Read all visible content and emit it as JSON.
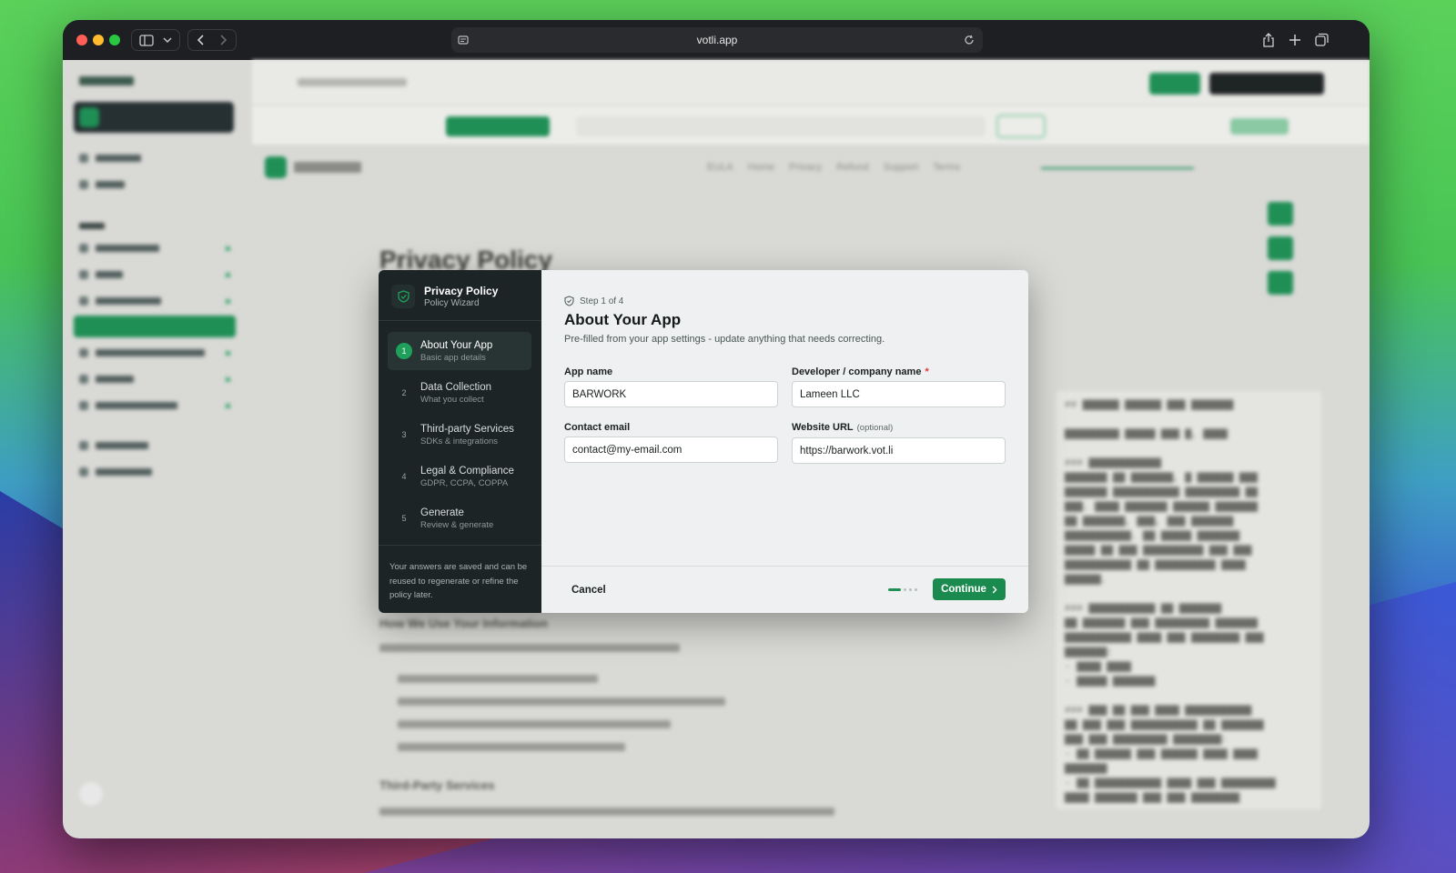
{
  "browser": {
    "url": "votli.app"
  },
  "background_app": {
    "nav_links": [
      "EULA",
      "Home",
      "Privacy",
      "Refund",
      "Support",
      "Terms"
    ],
    "page_title": "Privacy Policy",
    "section_heading_1": "How We Use Your Information",
    "section_heading_2": "Third-Party Services"
  },
  "modal": {
    "wizard_title": "Privacy Policy",
    "wizard_subtitle": "Policy Wizard",
    "steps": [
      {
        "num": "1",
        "title": "About Your App",
        "subtitle": "Basic app details"
      },
      {
        "num": "2",
        "title": "Data Collection",
        "subtitle": "What you collect"
      },
      {
        "num": "3",
        "title": "Third-party Services",
        "subtitle": "SDKs & integrations"
      },
      {
        "num": "4",
        "title": "Legal & Compliance",
        "subtitle": "GDPR, CCPA, COPPA"
      },
      {
        "num": "5",
        "title": "Generate",
        "subtitle": "Review & generate"
      }
    ],
    "note": "Your answers are saved and can be reused to regenerate or refine the policy later.",
    "step_indicator": "Step 1 of 4",
    "heading": "About Your App",
    "description": "Pre-filled from your app settings - update anything that needs correcting.",
    "fields": {
      "app_name": {
        "label": "App name",
        "value": "BARWORK"
      },
      "developer": {
        "label": "Developer / company name",
        "required_mark": "*",
        "value": "Lameen LLC"
      },
      "contact_email": {
        "label": "Contact email",
        "value": "contact@my-email.com"
      },
      "website_url": {
        "label": "Website URL",
        "optional_label": "(optional)",
        "value": "https://barwork.vot.li"
      }
    },
    "cancel_label": "Cancel",
    "continue_label": "Continue",
    "progress_fraction": 0.25
  },
  "colors": {
    "accent": "#1a8a4f",
    "sidebar_bg": "#1c2426",
    "required": "#e03a3a"
  }
}
